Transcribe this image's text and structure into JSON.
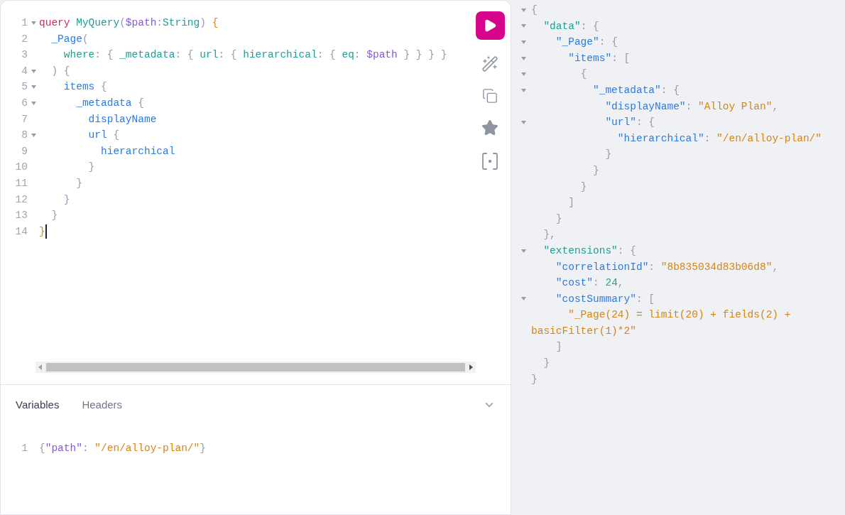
{
  "query_editor": {
    "lines": [
      {
        "number": "1",
        "foldable": true,
        "cursor": false,
        "tokens": [
          {
            "kind": "kw",
            "text": "query"
          },
          {
            "kind": "def",
            "text": " MyQuery"
          },
          {
            "kind": "p",
            "text": "("
          },
          {
            "kind": "var",
            "text": "$path"
          },
          {
            "kind": "p",
            "text": ":"
          },
          {
            "kind": "type",
            "text": "String"
          },
          {
            "kind": "p",
            "text": ") "
          },
          {
            "kind": "brace",
            "text": "{"
          }
        ]
      },
      {
        "number": "2",
        "foldable": false,
        "cursor": false,
        "tokens": [
          {
            "kind": "field",
            "text": "  _Page"
          },
          {
            "kind": "p",
            "text": "("
          }
        ]
      },
      {
        "number": "3",
        "foldable": false,
        "cursor": false,
        "tokens": [
          {
            "kind": "arg",
            "text": "    where"
          },
          {
            "kind": "p",
            "text": ": { "
          },
          {
            "kind": "arg",
            "text": "_metadata"
          },
          {
            "kind": "p",
            "text": ": { "
          },
          {
            "kind": "arg",
            "text": "url"
          },
          {
            "kind": "p",
            "text": ": { "
          },
          {
            "kind": "arg",
            "text": "hierarchical"
          },
          {
            "kind": "p",
            "text": ": { "
          },
          {
            "kind": "arg",
            "text": "eq"
          },
          {
            "kind": "p",
            "text": ": "
          },
          {
            "kind": "var",
            "text": "$path"
          },
          {
            "kind": "p",
            "text": " } } } }"
          }
        ]
      },
      {
        "number": "4",
        "foldable": true,
        "cursor": false,
        "tokens": [
          {
            "kind": "p",
            "text": "  ) {"
          }
        ]
      },
      {
        "number": "5",
        "foldable": true,
        "cursor": false,
        "tokens": [
          {
            "kind": "field",
            "text": "    items"
          },
          {
            "kind": "p",
            "text": " {"
          }
        ]
      },
      {
        "number": "6",
        "foldable": true,
        "cursor": false,
        "tokens": [
          {
            "kind": "field",
            "text": "      _metadata"
          },
          {
            "kind": "p",
            "text": " {"
          }
        ]
      },
      {
        "number": "7",
        "foldable": false,
        "cursor": false,
        "tokens": [
          {
            "kind": "field",
            "text": "        displayName"
          }
        ]
      },
      {
        "number": "8",
        "foldable": true,
        "cursor": false,
        "tokens": [
          {
            "kind": "field",
            "text": "        url"
          },
          {
            "kind": "p",
            "text": " {"
          }
        ]
      },
      {
        "number": "9",
        "foldable": false,
        "cursor": false,
        "tokens": [
          {
            "kind": "field",
            "text": "          hierarchical"
          }
        ]
      },
      {
        "number": "10",
        "foldable": false,
        "cursor": false,
        "tokens": [
          {
            "kind": "p",
            "text": "        }"
          }
        ]
      },
      {
        "number": "11",
        "foldable": false,
        "cursor": false,
        "tokens": [
          {
            "kind": "p",
            "text": "      }"
          }
        ]
      },
      {
        "number": "12",
        "foldable": false,
        "cursor": false,
        "tokens": [
          {
            "kind": "p",
            "text": "    }"
          }
        ]
      },
      {
        "number": "13",
        "foldable": false,
        "cursor": false,
        "tokens": [
          {
            "kind": "p",
            "text": "  }"
          }
        ]
      },
      {
        "number": "14",
        "foldable": false,
        "cursor": true,
        "tokens": [
          {
            "kind": "brace",
            "text": "}"
          }
        ]
      }
    ]
  },
  "toolbar": [
    {
      "kind": "run"
    },
    {
      "kind": "prettify"
    },
    {
      "kind": "copy"
    },
    {
      "kind": "favorite"
    },
    {
      "kind": "variables"
    }
  ],
  "bottom_tabs": [
    {
      "label": "Variables",
      "selected": true
    },
    {
      "label": "Headers",
      "selected": false
    }
  ],
  "variables_editor": {
    "lines": [
      {
        "number": "1",
        "tokens": [
          {
            "kind": "p",
            "text": "{"
          },
          {
            "kind": "var",
            "text": "\"path\""
          },
          {
            "kind": "p",
            "text": ": "
          },
          {
            "kind": "str",
            "text": "\"/en/alloy-plan/\""
          },
          {
            "kind": "p",
            "text": "}"
          }
        ]
      }
    ]
  },
  "result": {
    "lines": [
      {
        "foldable": true,
        "tokens": [
          {
            "kind": "p",
            "text": "{"
          }
        ]
      },
      {
        "foldable": true,
        "tokens": [
          {
            "kind": "key0",
            "text": "  \"data\""
          },
          {
            "kind": "p",
            "text": ": {"
          }
        ]
      },
      {
        "foldable": true,
        "tokens": [
          {
            "kind": "key",
            "text": "    \"_Page\""
          },
          {
            "kind": "p",
            "text": ": {"
          }
        ]
      },
      {
        "foldable": true,
        "tokens": [
          {
            "kind": "key",
            "text": "      \"items\""
          },
          {
            "kind": "p",
            "text": ": ["
          }
        ]
      },
      {
        "foldable": true,
        "tokens": [
          {
            "kind": "p",
            "text": "        {"
          }
        ]
      },
      {
        "foldable": true,
        "tokens": [
          {
            "kind": "key",
            "text": "          \"_metadata\""
          },
          {
            "kind": "p",
            "text": ": {"
          }
        ]
      },
      {
        "foldable": false,
        "tokens": [
          {
            "kind": "key",
            "text": "            \"displayName\""
          },
          {
            "kind": "p",
            "text": ": "
          },
          {
            "kind": "str",
            "text": "\"Alloy Plan\""
          },
          {
            "kind": "p",
            "text": ","
          }
        ]
      },
      {
        "foldable": true,
        "tokens": [
          {
            "kind": "key",
            "text": "            \"url\""
          },
          {
            "kind": "p",
            "text": ": {"
          }
        ]
      },
      {
        "foldable": false,
        "tokens": [
          {
            "kind": "key",
            "text": "              \"hierarchical\""
          },
          {
            "kind": "p",
            "text": ": "
          },
          {
            "kind": "str",
            "text": "\"/en/alloy-plan/\""
          }
        ]
      },
      {
        "foldable": false,
        "tokens": [
          {
            "kind": "p",
            "text": "            }"
          }
        ]
      },
      {
        "foldable": false,
        "tokens": [
          {
            "kind": "p",
            "text": "          }"
          }
        ]
      },
      {
        "foldable": false,
        "tokens": [
          {
            "kind": "p",
            "text": "        }"
          }
        ]
      },
      {
        "foldable": false,
        "tokens": [
          {
            "kind": "p",
            "text": "      ]"
          }
        ]
      },
      {
        "foldable": false,
        "tokens": [
          {
            "kind": "p",
            "text": "    }"
          }
        ]
      },
      {
        "foldable": false,
        "tokens": [
          {
            "kind": "p",
            "text": "  },"
          }
        ]
      },
      {
        "foldable": true,
        "tokens": [
          {
            "kind": "key0",
            "text": "  \"extensions\""
          },
          {
            "kind": "p",
            "text": ": {"
          }
        ]
      },
      {
        "foldable": false,
        "tokens": [
          {
            "kind": "key",
            "text": "    \"correlationId\""
          },
          {
            "kind": "p",
            "text": ": "
          },
          {
            "kind": "str",
            "text": "\"8b835034d83b06d8\""
          },
          {
            "kind": "p",
            "text": ","
          }
        ]
      },
      {
        "foldable": false,
        "tokens": [
          {
            "kind": "key",
            "text": "    \"cost\""
          },
          {
            "kind": "p",
            "text": ": "
          },
          {
            "kind": "num",
            "text": "24"
          },
          {
            "kind": "p",
            "text": ","
          }
        ]
      },
      {
        "foldable": true,
        "tokens": [
          {
            "kind": "key",
            "text": "    \"costSummary\""
          },
          {
            "kind": "p",
            "text": ": ["
          }
        ]
      },
      {
        "foldable": false,
        "tokens": [
          {
            "kind": "str",
            "text": "      \"_Page(24) = limit(20) + fields(2) + basicFilter(1)*2\""
          }
        ]
      },
      {
        "foldable": false,
        "tokens": [
          {
            "kind": "p",
            "text": "    ]"
          }
        ]
      },
      {
        "foldable": false,
        "tokens": [
          {
            "kind": "p",
            "text": "  }"
          }
        ]
      },
      {
        "foldable": false,
        "tokens": [
          {
            "kind": "p",
            "text": "}"
          }
        ]
      }
    ]
  }
}
